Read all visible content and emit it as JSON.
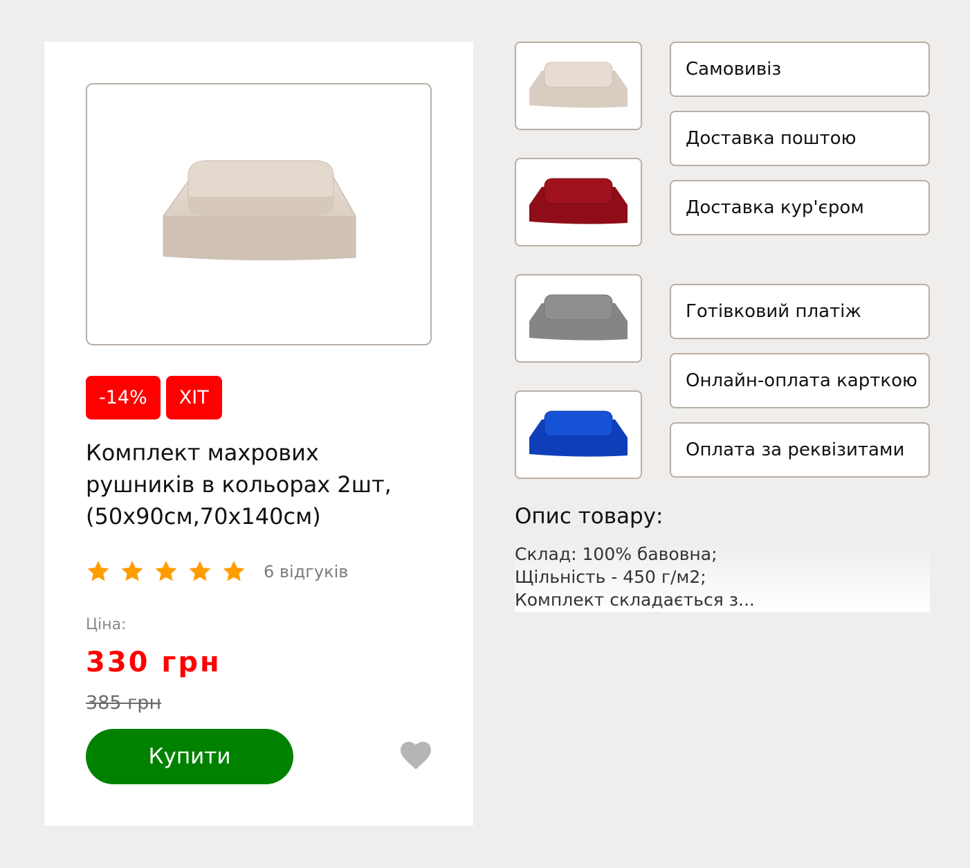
{
  "product": {
    "badges": [
      "-14%",
      "ХІТ"
    ],
    "title": "Комплект махрових рушників в кольорах 2шт, (50х90см,70х140см)",
    "rating": 5,
    "reviews": "6 відгуків",
    "price_label": "Ціна:",
    "price": "330 грн",
    "old_price": "385 грн",
    "buy_label": "Купити",
    "image_color": "#e0d2c6"
  },
  "thumbnails": [
    {
      "color": "#e0d2c6",
      "icon": "beige-towel-set"
    },
    {
      "color": "#9b0f1a",
      "icon": "red-towel-set"
    },
    {
      "color": "#8a8a8a",
      "icon": "gray-towel-set"
    },
    {
      "color": "#1446c8",
      "icon": "blue-towel-set"
    }
  ],
  "delivery_options": [
    "Самовивіз",
    "Доставка поштою",
    "Доставка кур'єром"
  ],
  "payment_options": [
    "Готівковий платіж",
    "Онлайн-оплата карткою",
    "Оплата за реквізитами"
  ],
  "description": {
    "title": "Опис товару:",
    "lines": [
      "Склад: 100% бавовна;",
      "Щільність - 450 г/м2;",
      "Комплект складається з..."
    ]
  },
  "colors": {
    "accent_red": "#ff0000",
    "buy_green": "#008200",
    "star": "#ff9d00",
    "border": "#b8aea6"
  }
}
